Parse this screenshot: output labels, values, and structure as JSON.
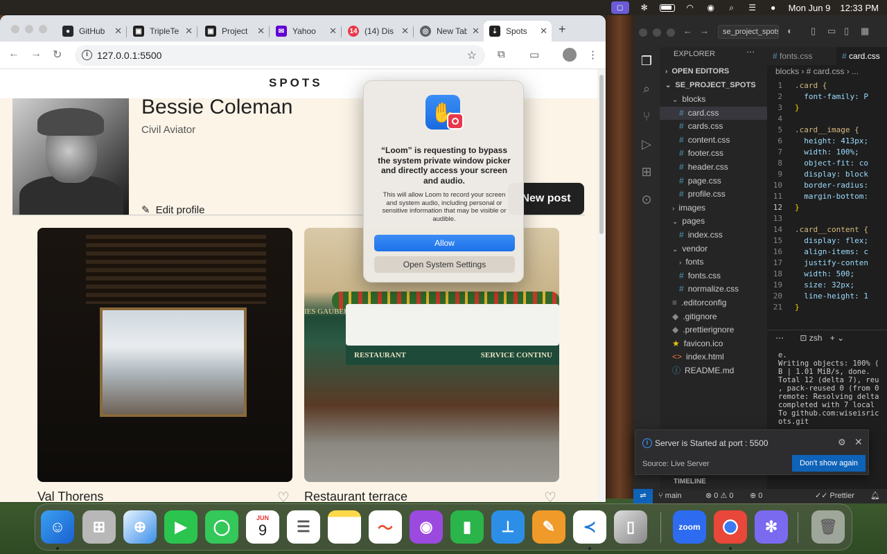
{
  "menubar": {
    "date": "Mon Jun 9",
    "time": "12:33 PM"
  },
  "browser": {
    "tabs": [
      {
        "label": "GitHub",
        "icon": "github-icon",
        "color": "#24292f"
      },
      {
        "label": "TripleTe",
        "icon": "tripleten-icon",
        "color": "#222222"
      },
      {
        "label": "Project",
        "icon": "tripleten-icon",
        "color": "#222222"
      },
      {
        "label": "Yahoo M",
        "icon": "yahoo-mail-icon",
        "color": "#6001d2"
      },
      {
        "label": "(14) Dis",
        "icon": "discord-icon",
        "color": "#e8394a"
      },
      {
        "label": "New Tab",
        "icon": "chrome-icon",
        "color": "#5f6368"
      },
      {
        "label": "Spots",
        "icon": "spots-icon",
        "color": "#212121"
      }
    ],
    "url": "127.0.0.1:5500"
  },
  "page": {
    "logo": "SPOTS",
    "profile_name": "Bessie Coleman",
    "profile_description": "Civil Aviator",
    "edit_profile_label": "Edit profile",
    "new_post_label": "New post",
    "cards": [
      {
        "title": "Val Thorens"
      },
      {
        "title": "Restaurant terrace"
      }
    ],
    "restaurant_sign_left": "RESTAURANT",
    "restaurant_sign_right": "SERVICE CONTINU",
    "restaurant_name": "IES GAUBERT"
  },
  "dialog": {
    "title": "“Loom” is requesting to bypass the system private window picker and directly access your screen and audio.",
    "body": "This will allow Loom to record your screen and system audio, including personal or sensitive information that may be visible or audible.",
    "allow_label": "Allow",
    "settings_label": "Open System Settings"
  },
  "vscode": {
    "search_text": "se_project_spots",
    "explorer_title": "EXPLORER",
    "open_editors": "OPEN EDITORS",
    "project": "SE_PROJECT_SPOTS",
    "tree": [
      {
        "label": "blocks",
        "type": "folder-open",
        "indent": 1
      },
      {
        "label": "card.css",
        "type": "css",
        "indent": 2,
        "selected": true
      },
      {
        "label": "cards.css",
        "type": "css",
        "indent": 2
      },
      {
        "label": "content.css",
        "type": "css",
        "indent": 2
      },
      {
        "label": "footer.css",
        "type": "css",
        "indent": 2
      },
      {
        "label": "header.css",
        "type": "css",
        "indent": 2
      },
      {
        "label": "page.css",
        "type": "css",
        "indent": 2
      },
      {
        "label": "profile.css",
        "type": "css",
        "indent": 2
      },
      {
        "label": "images",
        "type": "folder",
        "indent": 1
      },
      {
        "label": "pages",
        "type": "folder-open",
        "indent": 1
      },
      {
        "label": "index.css",
        "type": "css",
        "indent": 2
      },
      {
        "label": "vendor",
        "type": "folder-open",
        "indent": 1
      },
      {
        "label": "fonts",
        "type": "folder",
        "indent": 2
      },
      {
        "label": "fonts.css",
        "type": "css",
        "indent": 2
      },
      {
        "label": "normalize.css",
        "type": "css",
        "indent": 2
      },
      {
        "label": ".editorconfig",
        "type": "config",
        "indent": 1
      },
      {
        "label": ".gitignore",
        "type": "git",
        "indent": 1
      },
      {
        "label": ".prettierignore",
        "type": "git",
        "indent": 1
      },
      {
        "label": "favicon.ico",
        "type": "star",
        "indent": 1
      },
      {
        "label": "index.html",
        "type": "html",
        "indent": 1
      },
      {
        "label": "README.md",
        "type": "info",
        "indent": 1
      }
    ],
    "editor_tabs": [
      "fonts.css",
      "card.css"
    ],
    "breadcrumb": "blocks › # card.css › ...",
    "code": [
      {
        "n": "1",
        "text": ".card {",
        "kind": "sel"
      },
      {
        "n": "2",
        "text": "  font-family: P",
        "kind": "prop"
      },
      {
        "n": "3",
        "text": "}",
        "kind": "brace"
      },
      {
        "n": "4",
        "text": "",
        "kind": "plain"
      },
      {
        "n": "5",
        "text": ".card__image {",
        "kind": "sel"
      },
      {
        "n": "6",
        "text": "  height: 413px;",
        "kind": "prop"
      },
      {
        "n": "7",
        "text": "  width: 100%;",
        "kind": "prop"
      },
      {
        "n": "8",
        "text": "  object-fit: co",
        "kind": "prop"
      },
      {
        "n": "9",
        "text": "  display: block",
        "kind": "prop"
      },
      {
        "n": "10",
        "text": "  border-radius:",
        "kind": "prop"
      },
      {
        "n": "11",
        "text": "  margin-bottom:",
        "kind": "prop"
      },
      {
        "n": "12",
        "text": "}",
        "kind": "brace"
      },
      {
        "n": "13",
        "text": "",
        "kind": "plain"
      },
      {
        "n": "14",
        "text": ".card__content {",
        "kind": "sel"
      },
      {
        "n": "15",
        "text": "  display: flex;",
        "kind": "prop"
      },
      {
        "n": "16",
        "text": "  align-items: c",
        "kind": "prop"
      },
      {
        "n": "17",
        "text": "  justify-conten",
        "kind": "prop"
      },
      {
        "n": "18",
        "text": "  width: 500;",
        "kind": "prop"
      },
      {
        "n": "19",
        "text": "  size: 32px;",
        "kind": "prop"
      },
      {
        "n": "20",
        "text": "  line-height: 1",
        "kind": "prop"
      },
      {
        "n": "21",
        "text": "}",
        "kind": "brace"
      }
    ],
    "terminal_shell": "zsh",
    "terminal_lines": [
      "e.",
      "Writing objects: 100% (",
      "B | 1.01 MiB/s, done.",
      "Total 12 (delta 7), reu",
      ", pack-reused 0 (from 0",
      "remote: Resolving delta",
      "completed with 7 local",
      "To github.com:wiseisric",
      "ots.git"
    ],
    "timeline_label": "TIMELINE",
    "status_branch": "main",
    "status_errors": "0",
    "status_warnings": "0",
    "status_ports": "0",
    "status_prettier": "Prettier",
    "notification": {
      "message": "Server is Started at port : 5500",
      "source": "Source: Live Server",
      "button_label": "Don't show again"
    }
  },
  "dock": {
    "calendar_month": "JUN",
    "calendar_day": "9",
    "zoom_label": "zoom"
  }
}
